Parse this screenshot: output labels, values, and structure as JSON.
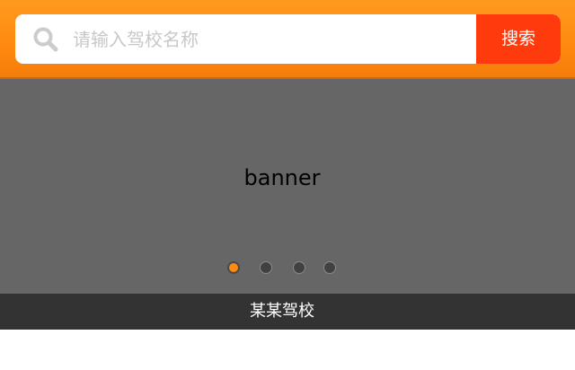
{
  "search": {
    "placeholder": "请输入驾校名称",
    "value": "",
    "button_label": "搜索",
    "icon": "search-icon"
  },
  "banner": {
    "text": "banner",
    "indicator_count": 4,
    "active_index": 0,
    "caption": "某某驾校"
  },
  "colors": {
    "header": "#ff8a10",
    "search_button": "#ff3a0c",
    "banner_bg": "#666666",
    "caption_bg": "#333333",
    "indicator_active": "#ff8a10",
    "indicator_inactive": "#414141"
  }
}
